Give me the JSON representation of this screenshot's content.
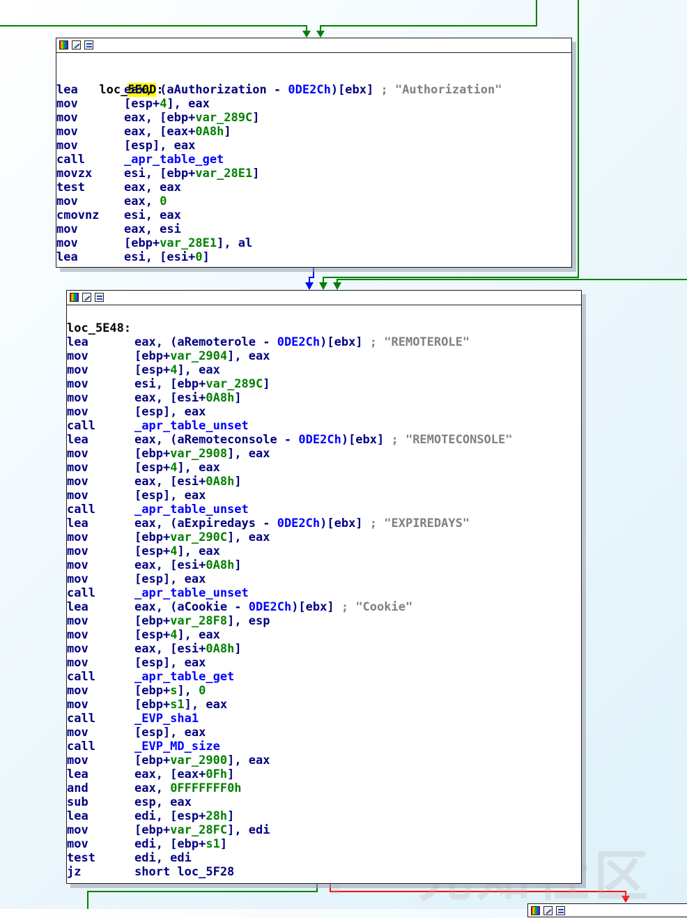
{
  "colors": {
    "edge_true": "#008000",
    "edge_false": "#ff0000",
    "edge_flow": "#0000ff",
    "mnemonic": "#000080",
    "number": "#008000",
    "symbol": "#0000ff",
    "comment": "#808080",
    "highlight": "#ffff00"
  },
  "icons": [
    "color-palette-icon",
    "rename-icon",
    "graph-overview-icon"
  ],
  "block1": {
    "label_prefix": "loc_",
    "label_highlight": "5E0D",
    "label_suffix": ":",
    "lines": [
      {
        "mn": "lea",
        "ops": [
          {
            "t": "eax, (aAuthorization - "
          },
          {
            "t": "0DE2Ch",
            "c": "sym"
          },
          {
            "t": ")[ebx] "
          },
          {
            "t": "; \"Authorization\"",
            "c": "cmt"
          }
        ]
      },
      {
        "mn": "mov",
        "ops": [
          {
            "t": "[esp+"
          },
          {
            "t": "4",
            "c": "num"
          },
          {
            "t": "], eax"
          }
        ]
      },
      {
        "mn": "mov",
        "ops": [
          {
            "t": "eax, [ebp+"
          },
          {
            "t": "var_289C",
            "c": "var"
          },
          {
            "t": "]"
          }
        ]
      },
      {
        "mn": "mov",
        "ops": [
          {
            "t": "eax, [eax+"
          },
          {
            "t": "0A8h",
            "c": "num"
          },
          {
            "t": "]"
          }
        ]
      },
      {
        "mn": "mov",
        "ops": [
          {
            "t": "[esp], eax"
          }
        ]
      },
      {
        "mn": "call",
        "ops": [
          {
            "t": "_apr_table_get",
            "c": "sym"
          }
        ]
      },
      {
        "mn": "movzx",
        "ops": [
          {
            "t": "esi, [ebp+"
          },
          {
            "t": "var_28E1",
            "c": "var"
          },
          {
            "t": "]"
          }
        ]
      },
      {
        "mn": "test",
        "ops": [
          {
            "t": "eax, eax"
          }
        ]
      },
      {
        "mn": "mov",
        "ops": [
          {
            "t": "eax, "
          },
          {
            "t": "0",
            "c": "num"
          }
        ]
      },
      {
        "mn": "cmovnz",
        "ops": [
          {
            "t": "esi, eax"
          }
        ]
      },
      {
        "mn": "mov",
        "ops": [
          {
            "t": "eax, esi"
          }
        ]
      },
      {
        "mn": "mov",
        "ops": [
          {
            "t": "[ebp+"
          },
          {
            "t": "var_28E1",
            "c": "var"
          },
          {
            "t": "], al"
          }
        ]
      },
      {
        "mn": "lea",
        "ops": [
          {
            "t": "esi, [esi+"
          },
          {
            "t": "0",
            "c": "num"
          },
          {
            "t": "]"
          }
        ]
      }
    ]
  },
  "block2": {
    "label": "loc_5E48:",
    "lines": [
      {
        "mn": "lea",
        "ops": [
          {
            "t": "eax, (aRemoterole - "
          },
          {
            "t": "0DE2Ch",
            "c": "sym"
          },
          {
            "t": ")[ebx] "
          },
          {
            "t": "; \"REMOTEROLE\"",
            "c": "cmt"
          }
        ]
      },
      {
        "mn": "mov",
        "ops": [
          {
            "t": "[ebp+"
          },
          {
            "t": "var_2904",
            "c": "var"
          },
          {
            "t": "], eax"
          }
        ]
      },
      {
        "mn": "mov",
        "ops": [
          {
            "t": "[esp+"
          },
          {
            "t": "4",
            "c": "num"
          },
          {
            "t": "], eax"
          }
        ]
      },
      {
        "mn": "mov",
        "ops": [
          {
            "t": "esi, [ebp+"
          },
          {
            "t": "var_289C",
            "c": "var"
          },
          {
            "t": "]"
          }
        ]
      },
      {
        "mn": "mov",
        "ops": [
          {
            "t": "eax, [esi+"
          },
          {
            "t": "0A8h",
            "c": "num"
          },
          {
            "t": "]"
          }
        ]
      },
      {
        "mn": "mov",
        "ops": [
          {
            "t": "[esp], eax"
          }
        ]
      },
      {
        "mn": "call",
        "ops": [
          {
            "t": "_apr_table_unset",
            "c": "sym"
          }
        ]
      },
      {
        "mn": "lea",
        "ops": [
          {
            "t": "eax, (aRemoteconsole - "
          },
          {
            "t": "0DE2Ch",
            "c": "sym"
          },
          {
            "t": ")[ebx] "
          },
          {
            "t": "; \"REMOTECONSOLE\"",
            "c": "cmt"
          }
        ]
      },
      {
        "mn": "mov",
        "ops": [
          {
            "t": "[ebp+"
          },
          {
            "t": "var_2908",
            "c": "var"
          },
          {
            "t": "], eax"
          }
        ]
      },
      {
        "mn": "mov",
        "ops": [
          {
            "t": "[esp+"
          },
          {
            "t": "4",
            "c": "num"
          },
          {
            "t": "], eax"
          }
        ]
      },
      {
        "mn": "mov",
        "ops": [
          {
            "t": "eax, [esi+"
          },
          {
            "t": "0A8h",
            "c": "num"
          },
          {
            "t": "]"
          }
        ]
      },
      {
        "mn": "mov",
        "ops": [
          {
            "t": "[esp], eax"
          }
        ]
      },
      {
        "mn": "call",
        "ops": [
          {
            "t": "_apr_table_unset",
            "c": "sym"
          }
        ]
      },
      {
        "mn": "lea",
        "ops": [
          {
            "t": "eax, (aExpiredays - "
          },
          {
            "t": "0DE2Ch",
            "c": "sym"
          },
          {
            "t": ")[ebx] "
          },
          {
            "t": "; \"EXPIREDAYS\"",
            "c": "cmt"
          }
        ]
      },
      {
        "mn": "mov",
        "ops": [
          {
            "t": "[ebp+"
          },
          {
            "t": "var_290C",
            "c": "var"
          },
          {
            "t": "], eax"
          }
        ]
      },
      {
        "mn": "mov",
        "ops": [
          {
            "t": "[esp+"
          },
          {
            "t": "4",
            "c": "num"
          },
          {
            "t": "], eax"
          }
        ]
      },
      {
        "mn": "mov",
        "ops": [
          {
            "t": "eax, [esi+"
          },
          {
            "t": "0A8h",
            "c": "num"
          },
          {
            "t": "]"
          }
        ]
      },
      {
        "mn": "mov",
        "ops": [
          {
            "t": "[esp], eax"
          }
        ]
      },
      {
        "mn": "call",
        "ops": [
          {
            "t": "_apr_table_unset",
            "c": "sym"
          }
        ]
      },
      {
        "mn": "lea",
        "ops": [
          {
            "t": "eax, (aCookie - "
          },
          {
            "t": "0DE2Ch",
            "c": "sym"
          },
          {
            "t": ")[ebx] "
          },
          {
            "t": "; \"Cookie\"",
            "c": "cmt"
          }
        ]
      },
      {
        "mn": "mov",
        "ops": [
          {
            "t": "[ebp+"
          },
          {
            "t": "var_28F8",
            "c": "var"
          },
          {
            "t": "], esp"
          }
        ]
      },
      {
        "mn": "mov",
        "ops": [
          {
            "t": "[esp+"
          },
          {
            "t": "4",
            "c": "num"
          },
          {
            "t": "], eax"
          }
        ]
      },
      {
        "mn": "mov",
        "ops": [
          {
            "t": "eax, [esi+"
          },
          {
            "t": "0A8h",
            "c": "num"
          },
          {
            "t": "]"
          }
        ]
      },
      {
        "mn": "mov",
        "ops": [
          {
            "t": "[esp], eax"
          }
        ]
      },
      {
        "mn": "call",
        "ops": [
          {
            "t": "_apr_table_get",
            "c": "sym"
          }
        ]
      },
      {
        "mn": "mov",
        "ops": [
          {
            "t": "[ebp+"
          },
          {
            "t": "s",
            "c": "var"
          },
          {
            "t": "], "
          },
          {
            "t": "0",
            "c": "num"
          }
        ]
      },
      {
        "mn": "mov",
        "ops": [
          {
            "t": "[ebp+"
          },
          {
            "t": "s1",
            "c": "var"
          },
          {
            "t": "], eax"
          }
        ]
      },
      {
        "mn": "call",
        "ops": [
          {
            "t": "_EVP_sha1",
            "c": "sym"
          }
        ]
      },
      {
        "mn": "mov",
        "ops": [
          {
            "t": "[esp], eax"
          }
        ]
      },
      {
        "mn": "call",
        "ops": [
          {
            "t": "_EVP_MD_size",
            "c": "sym"
          }
        ]
      },
      {
        "mn": "mov",
        "ops": [
          {
            "t": "[ebp+"
          },
          {
            "t": "var_2900",
            "c": "var"
          },
          {
            "t": "], eax"
          }
        ]
      },
      {
        "mn": "lea",
        "ops": [
          {
            "t": "eax, [eax+"
          },
          {
            "t": "0Fh",
            "c": "num"
          },
          {
            "t": "]"
          }
        ]
      },
      {
        "mn": "and",
        "ops": [
          {
            "t": "eax, "
          },
          {
            "t": "0FFFFFFF0h",
            "c": "num"
          }
        ]
      },
      {
        "mn": "sub",
        "ops": [
          {
            "t": "esp, eax"
          }
        ]
      },
      {
        "mn": "lea",
        "ops": [
          {
            "t": "edi, [esp+"
          },
          {
            "t": "28h",
            "c": "num"
          },
          {
            "t": "]"
          }
        ]
      },
      {
        "mn": "mov",
        "ops": [
          {
            "t": "[ebp+"
          },
          {
            "t": "var_28FC",
            "c": "var"
          },
          {
            "t": "], edi"
          }
        ]
      },
      {
        "mn": "mov",
        "ops": [
          {
            "t": "edi, [ebp+"
          },
          {
            "t": "s1",
            "c": "var"
          },
          {
            "t": "]"
          }
        ]
      },
      {
        "mn": "test",
        "ops": [
          {
            "t": "edi, edi"
          }
        ]
      },
      {
        "mn": "jz",
        "ops": [
          {
            "t": "short loc_5F28"
          }
        ]
      }
    ]
  },
  "watermark": "先知社区"
}
